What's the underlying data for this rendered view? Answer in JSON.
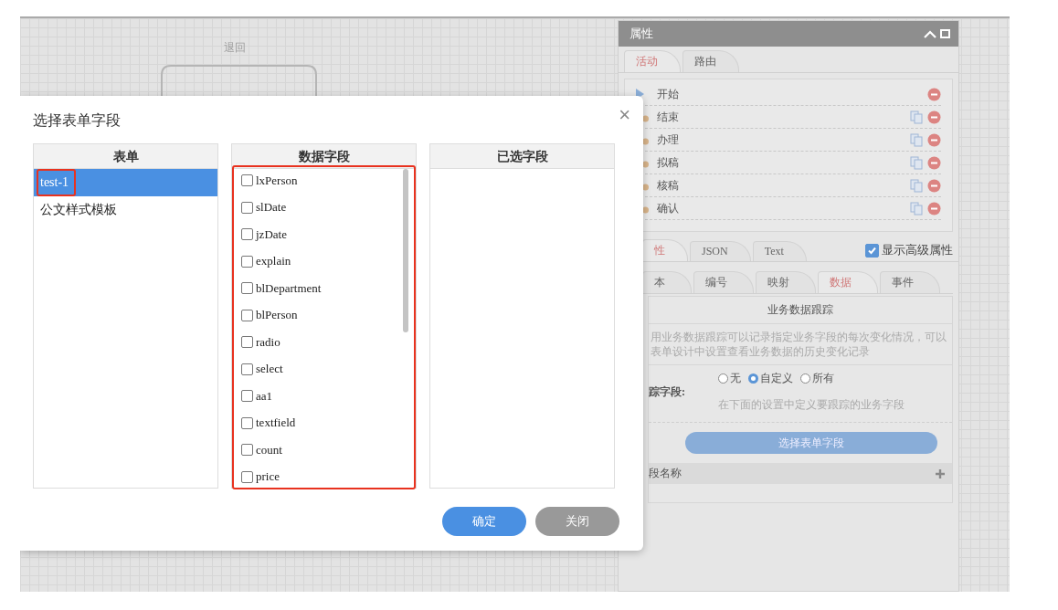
{
  "canvas": {
    "label": "退回"
  },
  "panel": {
    "title": "属性",
    "tabs": [
      {
        "label": "活动",
        "selected": true
      },
      {
        "label": "路由",
        "selected": false
      }
    ],
    "activities": [
      {
        "name": "开始",
        "kind": "start",
        "copyable": false
      },
      {
        "name": "结束",
        "kind": "task",
        "copyable": true
      },
      {
        "name": "办理",
        "kind": "task",
        "copyable": true
      },
      {
        "name": "拟稿",
        "kind": "task",
        "copyable": true
      },
      {
        "name": "核稿",
        "kind": "task",
        "copyable": true
      },
      {
        "name": "确认",
        "kind": "task",
        "copyable": true
      }
    ],
    "detail_tabs": [
      {
        "label": "性",
        "selected": true
      },
      {
        "label": "JSON",
        "selected": false
      },
      {
        "label": "Text",
        "selected": false
      }
    ],
    "advanced": {
      "label": "显示高级属性",
      "checked": true
    },
    "sub_tabs": [
      {
        "label": "本",
        "selected": false
      },
      {
        "label": "编号",
        "selected": false
      },
      {
        "label": "映射",
        "selected": false
      },
      {
        "label": "数据",
        "selected": true
      },
      {
        "label": "事件",
        "selected": false
      }
    ],
    "section_title": "业务数据跟踪",
    "description": [
      "用业务数据跟踪可以记录指定业务字段的每次变化情况，可以",
      "表单设计中设置查看业务数据的历史变化记录"
    ],
    "track_label": "踪字段:",
    "track_options": [
      {
        "label": "无",
        "selected": false
      },
      {
        "label": "自定义",
        "selected": true
      },
      {
        "label": "所有",
        "selected": false
      }
    ],
    "hint": "在下面的设置中定义要跟踪的业务字段",
    "select_button": "选择表单字段",
    "field_header": "段名称"
  },
  "dialog": {
    "title": "选择表单字段",
    "close": "×",
    "columns": [
      "表单",
      "数据字段",
      "已选字段"
    ],
    "forms": [
      {
        "label": "test-1",
        "selected": true,
        "highlighted": true
      },
      {
        "label": "公文样式模板",
        "selected": false,
        "highlighted": false
      }
    ],
    "fields_highlighted": true,
    "fields": [
      {
        "label": "lxPerson",
        "checked": false
      },
      {
        "label": "slDate",
        "checked": false
      },
      {
        "label": "jzDate",
        "checked": false
      },
      {
        "label": "explain",
        "checked": false
      },
      {
        "label": "blDepartment",
        "checked": false
      },
      {
        "label": "blPerson",
        "checked": false
      },
      {
        "label": "radio",
        "checked": false
      },
      {
        "label": "select",
        "checked": false
      },
      {
        "label": "aa1",
        "checked": false
      },
      {
        "label": "textfield",
        "checked": false
      },
      {
        "label": "count",
        "checked": false
      },
      {
        "label": "price",
        "checked": false
      }
    ],
    "buttons": [
      {
        "label": "确定",
        "kind": "primary"
      },
      {
        "label": "关闭",
        "kind": "secondary"
      }
    ]
  }
}
